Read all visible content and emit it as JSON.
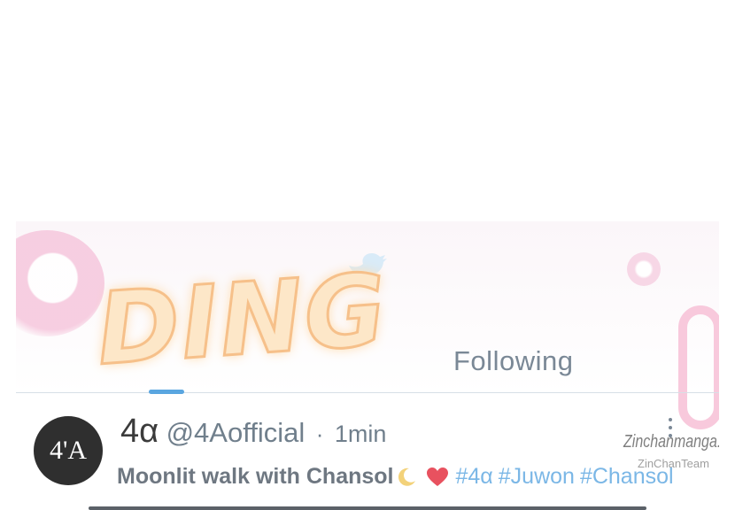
{
  "sfx": {
    "text": "DING"
  },
  "tabs": {
    "following_label": "Following"
  },
  "tweet": {
    "avatar_text": "4'A",
    "display_name": "4α",
    "handle": "@4Aofficial",
    "separator": "·",
    "time": "1min",
    "text": "Moonlit walk with Chansol",
    "hashtags": [
      "#4α",
      "#Juwon",
      "#Chansol"
    ]
  },
  "watermark": {
    "main": "Zinchanmanga.net",
    "sub": "ZinChanTeam"
  },
  "colors": {
    "accent_blue": "#5aa6e0",
    "hashtag_blue": "#7bb7e6",
    "heart_red": "#e8515f",
    "moon_yellow": "#f3d27a",
    "ding_fill": "#fde7c8",
    "ding_outline": "#f6c08a"
  },
  "icons": [
    "bird-icon",
    "more-icon",
    "moon-icon",
    "heart-icon"
  ]
}
